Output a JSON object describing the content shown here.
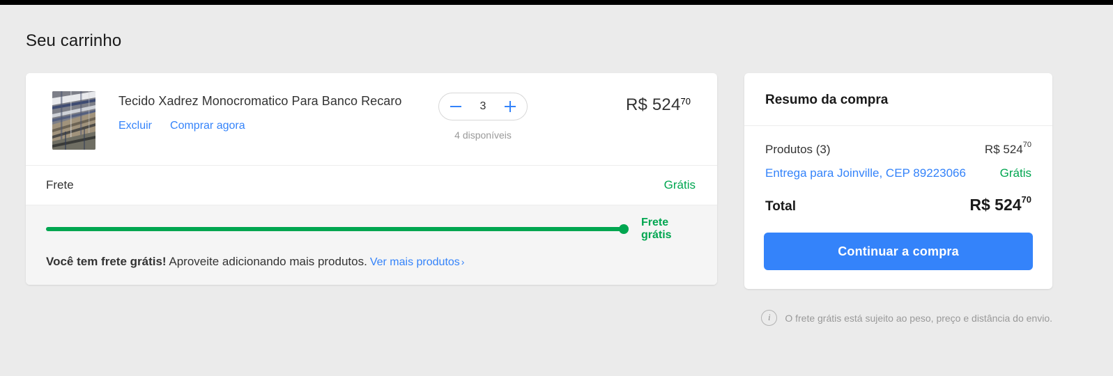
{
  "page": {
    "title": "Seu carrinho",
    "background_color": "#ebebeb",
    "accent_blue": "#3483fa",
    "accent_green": "#00a650"
  },
  "cart": {
    "item": {
      "title": "Tecido Xadrez Monocromatico Para Banco Recaro",
      "thumbnail_alt": "plaid-fabric-photo",
      "delete_label": "Excluir",
      "buy_now_label": "Comprar agora",
      "quantity": "3",
      "decrease_label": "−",
      "increase_label": "+",
      "stock_label": "4 disponíveis",
      "price_currency": "R$",
      "price_amount": "524",
      "price_cents": "70",
      "price_full": "R$ 524"
    },
    "shipping_row": {
      "label": "Frete",
      "value": "Grátis"
    },
    "promo": {
      "progress_percent": 100,
      "progress_label": "Frete grátis",
      "message_bold": "Você tem frete grátis!",
      "message_rest": "Aproveite adicionando mais produtos.",
      "link_label": "Ver mais produtos",
      "link_chevron": "›"
    }
  },
  "summary": {
    "heading": "Resumo da compra",
    "rows": [
      {
        "label": "Produtos (3)",
        "value": "R$ 524",
        "value_cents": "70",
        "value_color": "default",
        "is_link": false
      },
      {
        "label": "Entrega para Joinville, CEP 89223066",
        "value": "Grátis",
        "value_cents": "",
        "value_color": "green",
        "is_link": true
      }
    ],
    "total": {
      "label": "Total",
      "value": "R$ 524",
      "value_cents": "70"
    },
    "cta_label": "Continuar a compra",
    "footnote": {
      "icon": "info-icon",
      "text": "O frete grátis está sujeito ao peso, preço e distância do envio."
    }
  }
}
